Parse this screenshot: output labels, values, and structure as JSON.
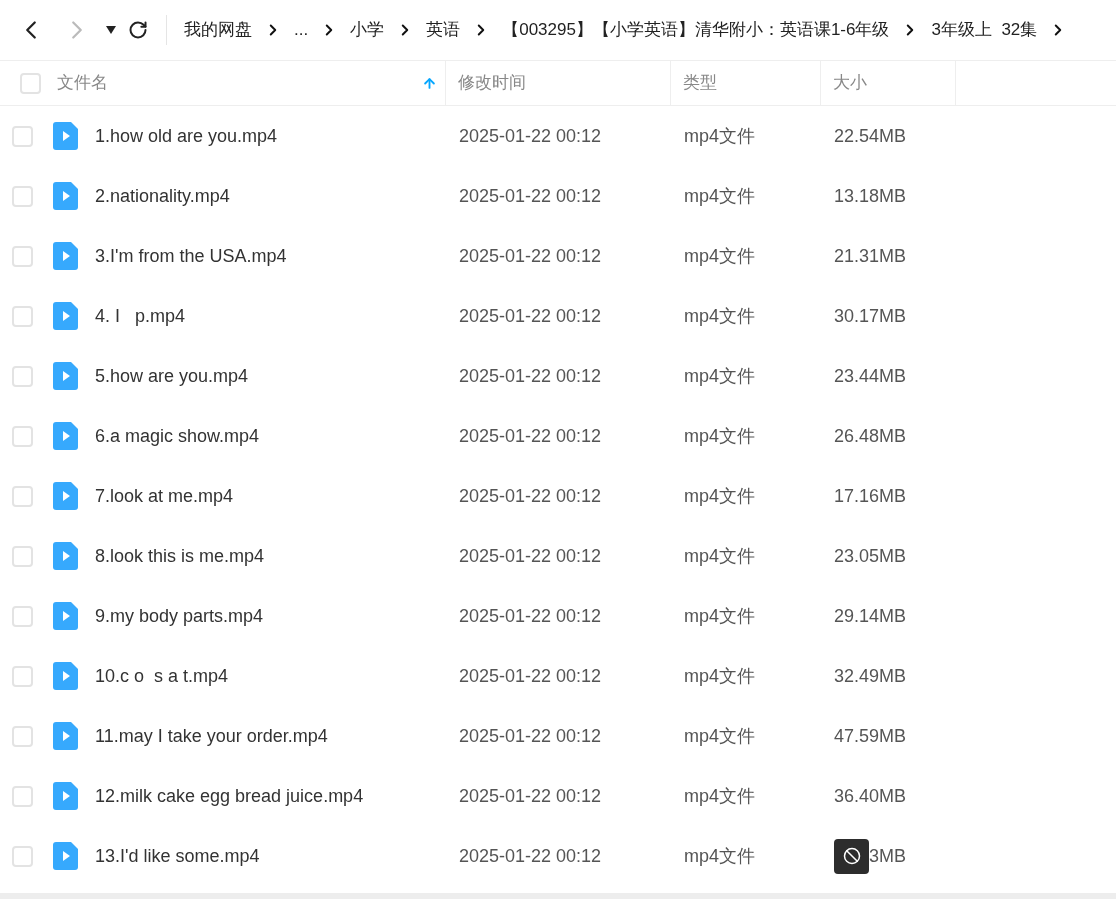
{
  "nav": {
    "back": {
      "disabled": false
    },
    "forward": {
      "disabled": true
    }
  },
  "breadcrumb": [
    "我的网盘",
    "...",
    "小学",
    "英语",
    "【003295】【小学英语】清华附小：英语课1-6年级",
    "3年级上  32集"
  ],
  "table": {
    "select_all": {
      "checked": false
    },
    "columns": [
      {
        "label": "文件名",
        "sorted": true
      },
      {
        "label": "修改时间",
        "sorted": false
      },
      {
        "label": "类型",
        "sorted": false
      },
      {
        "label": "大小",
        "sorted": false
      }
    ],
    "rows": [
      {
        "checked": false,
        "name": "1.how old are you.mp4",
        "modified": "2025-01-22 00:12",
        "type": "mp4文件",
        "size": "22.54MB",
        "badge": false
      },
      {
        "checked": false,
        "name": "2.nationality.mp4",
        "modified": "2025-01-22 00:12",
        "type": "mp4文件",
        "size": "13.18MB",
        "badge": false
      },
      {
        "checked": false,
        "name": "3.I'm from the USA.mp4",
        "modified": "2025-01-22 00:12",
        "type": "mp4文件",
        "size": "21.31MB",
        "badge": false
      },
      {
        "checked": false,
        "name": "4. I   p.mp4",
        "modified": "2025-01-22 00:12",
        "type": "mp4文件",
        "size": "30.17MB",
        "badge": false
      },
      {
        "checked": false,
        "name": "5.how are you.mp4",
        "modified": "2025-01-22 00:12",
        "type": "mp4文件",
        "size": "23.44MB",
        "badge": false
      },
      {
        "checked": false,
        "name": "6.a magic show.mp4",
        "modified": "2025-01-22 00:12",
        "type": "mp4文件",
        "size": "26.48MB",
        "badge": false
      },
      {
        "checked": false,
        "name": "7.look at me.mp4",
        "modified": "2025-01-22 00:12",
        "type": "mp4文件",
        "size": "17.16MB",
        "badge": false
      },
      {
        "checked": false,
        "name": "8.look this is me.mp4",
        "modified": "2025-01-22 00:12",
        "type": "mp4文件",
        "size": "23.05MB",
        "badge": false
      },
      {
        "checked": false,
        "name": "9.my body parts.mp4",
        "modified": "2025-01-22 00:12",
        "type": "mp4文件",
        "size": "29.14MB",
        "badge": false
      },
      {
        "checked": false,
        "name": "10.c o  s a t.mp4",
        "modified": "2025-01-22 00:12",
        "type": "mp4文件",
        "size": "32.49MB",
        "badge": false
      },
      {
        "checked": false,
        "name": "11.may I take your order.mp4",
        "modified": "2025-01-22 00:12",
        "type": "mp4文件",
        "size": "47.59MB",
        "badge": false
      },
      {
        "checked": false,
        "name": "12.milk cake egg bread juice.mp4",
        "modified": "2025-01-22 00:12",
        "type": "mp4文件",
        "size": "36.40MB",
        "badge": false
      },
      {
        "checked": false,
        "name": "13.I'd like some.mp4",
        "modified": "2025-01-22 00:12",
        "type": "mp4文件",
        "size": "3MB",
        "badge": true
      }
    ]
  }
}
